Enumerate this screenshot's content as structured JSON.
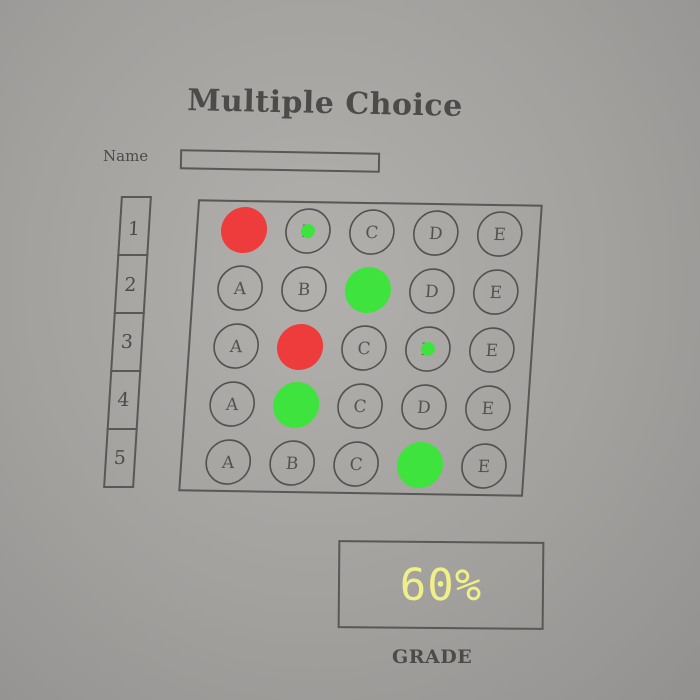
{
  "sheet": {
    "title": "Multiple Choice",
    "name_label": "Name",
    "name_value": ""
  },
  "questions": [
    {
      "number": "1",
      "choices": [
        "A",
        "B",
        "C",
        "D",
        "E"
      ],
      "marks": [
        {
          "choice": "A",
          "status": "incorrect"
        },
        {
          "choice": "B",
          "status": "correct-answer"
        }
      ]
    },
    {
      "number": "2",
      "choices": [
        "A",
        "B",
        "C",
        "D",
        "E"
      ],
      "marks": [
        {
          "choice": "C",
          "status": "correct"
        }
      ]
    },
    {
      "number": "3",
      "choices": [
        "A",
        "B",
        "C",
        "D",
        "E"
      ],
      "marks": [
        {
          "choice": "B",
          "status": "incorrect"
        },
        {
          "choice": "D",
          "status": "correct-answer"
        }
      ]
    },
    {
      "number": "4",
      "choices": [
        "A",
        "B",
        "C",
        "D",
        "E"
      ],
      "marks": [
        {
          "choice": "B",
          "status": "correct"
        }
      ]
    },
    {
      "number": "5",
      "choices": [
        "A",
        "B",
        "C",
        "D",
        "E"
      ],
      "marks": [
        {
          "choice": "D",
          "status": "correct"
        }
      ]
    }
  ],
  "grade": {
    "value": "60%",
    "label": "GRADE"
  },
  "colors": {
    "correct": "#3ee33e",
    "incorrect": "#ee3b3b",
    "grade_text": "#f0f08a",
    "paper": "#a8a6a3",
    "ink": "#4d4b4a"
  }
}
